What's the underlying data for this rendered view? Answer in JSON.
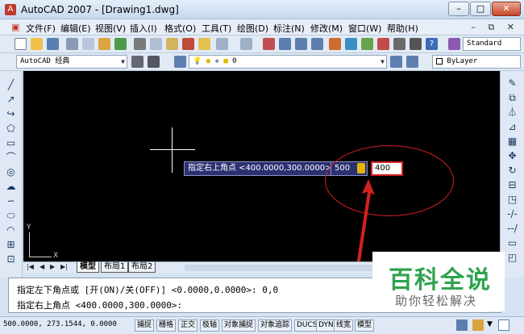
{
  "window": {
    "title": "AutoCAD 2007 - [Drawing1.dwg]",
    "app_icon": "autocad-icon",
    "controls": [
      "–",
      "□",
      "✕"
    ],
    "mdi_controls": "– ⧉ ✕"
  },
  "menu": {
    "items": [
      "文件(F)",
      "编辑(E)",
      "视图(V)",
      "插入(I)",
      "格式(O)",
      "工具(T)",
      "绘图(D)",
      "标注(N)",
      "修改(M)",
      "窗口(W)",
      "帮助(H)"
    ]
  },
  "toolbar1": {
    "text_style": "Standard"
  },
  "toolbar2": {
    "workspace": "AutoCAD 经典",
    "layer": "0",
    "color": "ByLayer"
  },
  "canvas": {
    "ucs_x_label": "X",
    "ucs_y_label": "Y"
  },
  "dynamic_input": {
    "prompt": "指定右上角点 <400.0000,300.0000>:",
    "first_value": "500",
    "second_value": "400"
  },
  "tabs": {
    "items": [
      "模型",
      "布局1",
      "布局2"
    ],
    "active": "模型"
  },
  "command": {
    "line1": "指定左下角点或 [开(ON)/关(OFF)] <0.0000,0.0000>: 0,0",
    "line2": "指定右上角点 <400.0000,300.0000>:"
  },
  "status": {
    "coords": "500.0000,  273.1544,  0.0000",
    "buttons": [
      "捕捉",
      "栅格",
      "正交",
      "极轴",
      "对象捕捉",
      "对象追踪",
      "DUCS",
      "DYN",
      "线宽",
      "模型"
    ]
  },
  "watermark": {
    "title": "百科全说",
    "subtitle": "助你轻松解决"
  },
  "colors": {
    "canvas": "#000000",
    "highlight": "#d52020",
    "watermark_green": "#2fa34f"
  }
}
